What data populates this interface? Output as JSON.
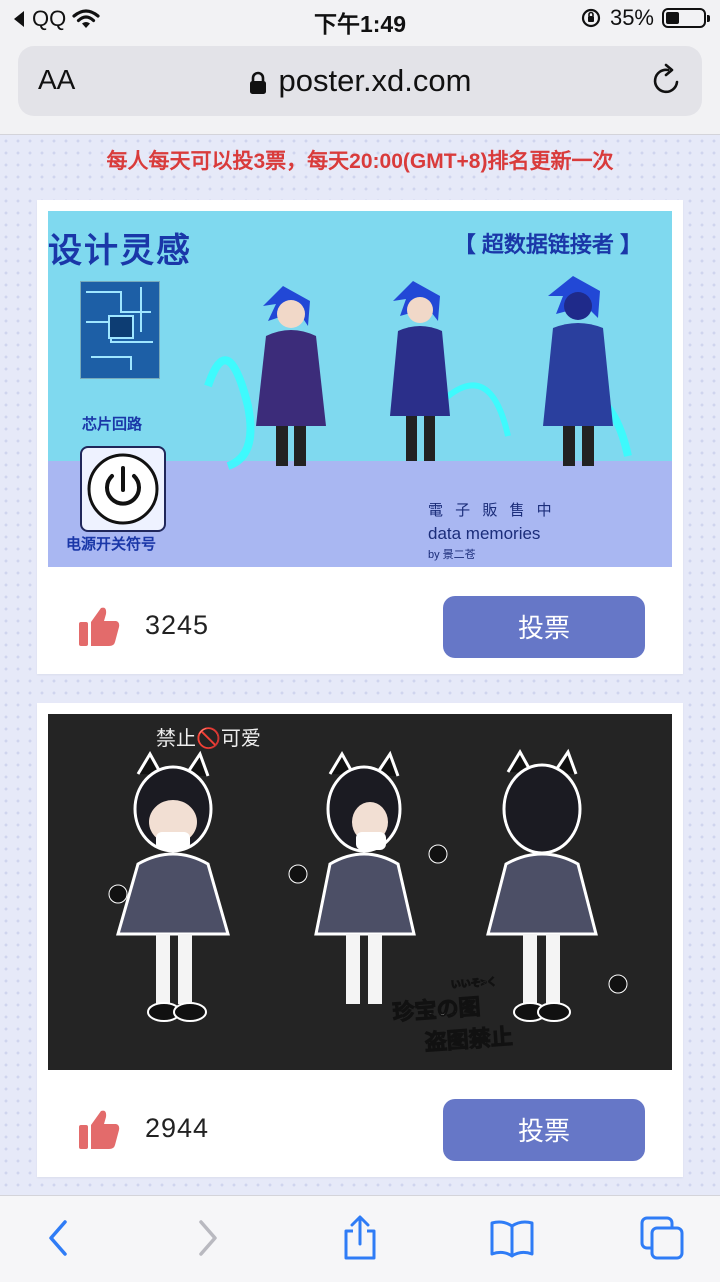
{
  "status_bar": {
    "carrier": "QQ",
    "time": "下午1:49",
    "battery_percent": "35%",
    "battery_level": 0.35
  },
  "browser": {
    "text_size_label": "AA",
    "url": "poster.xd.com"
  },
  "page": {
    "notice": "每人每天可以投3票，每天20:00(GMT+8)排名更新一次",
    "entries": [
      {
        "votes": "3245",
        "vote_label": "投票",
        "poster": {
          "title": "设计灵感",
          "subtitle": "【 超数据链接者 】",
          "chip_label": "芯片回路",
          "power_label": "电源开关符号",
          "caption_line1": "電 子 販 售 中",
          "caption_line2": "data memories",
          "caption_line3": "by 景二苍"
        }
      },
      {
        "votes": "2944",
        "vote_label": "投票",
        "poster": {
          "top_text": "禁止🚫可爱",
          "watermark_small": "いいそ>く",
          "watermark_line1": "珍宝の图",
          "watermark_line2": "盗图禁止"
        }
      }
    ]
  },
  "colors": {
    "accent_button": "#6677c7",
    "notice_red": "#d93b3b",
    "thumb_red": "#e36b6b",
    "ios_blue": "#2f7cf6"
  },
  "icons": [
    "back-arrow-icon",
    "wifi-icon",
    "lock-icon",
    "reload-icon",
    "thumbs-up-icon",
    "chevron-left-icon",
    "chevron-right-icon",
    "share-icon",
    "bookmarks-icon",
    "tabs-icon"
  ]
}
